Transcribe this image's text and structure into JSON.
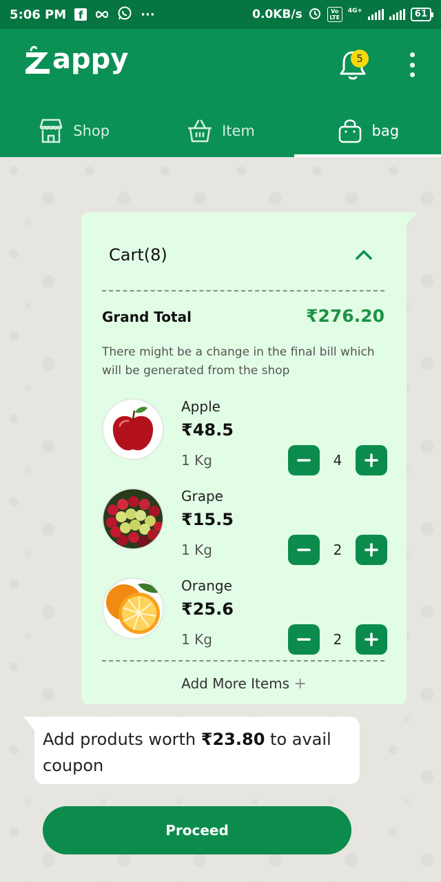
{
  "status_bar": {
    "time": "5:06 PM",
    "dots": "···",
    "speed": "0.0KB/s",
    "network": "4G+",
    "volte": "Vo LTE",
    "battery": "61"
  },
  "app": {
    "logo_text": "appy",
    "notification_count": "5"
  },
  "tabs": [
    {
      "label": "Shop",
      "icon": "shop-icon",
      "active": false
    },
    {
      "label": "Item",
      "icon": "basket-icon",
      "active": false
    },
    {
      "label": "bag",
      "icon": "bag-icon",
      "active": true
    }
  ],
  "cart": {
    "title": "Cart(8)",
    "grand_total_label": "Grand Total",
    "grand_total_value": "₹276.20",
    "note": "There might be a change in the final bill which will be generated from the shop",
    "items": [
      {
        "name": "Apple",
        "price": "₹48.5",
        "unit": "1 Kg",
        "qty": "4",
        "image": "apple-image"
      },
      {
        "name": "Grape",
        "price": "₹15.5",
        "unit": "1 Kg",
        "qty": "2",
        "image": "grape-image"
      },
      {
        "name": "Orange",
        "price": "₹25.6",
        "unit": "1 Kg",
        "qty": "2",
        "image": "orange-image"
      }
    ],
    "add_more_label": "Add More Items",
    "add_more_icon": "+"
  },
  "coupon": {
    "prefix": "Add produts worth ",
    "amount": "₹23.80",
    "suffix": " to avail coupon"
  },
  "proceed_label": "Proceed",
  "colors": {
    "primary": "#0b9155",
    "status_bar": "#067542",
    "button": "#0b8c4d",
    "card_bg": "#e2fde6",
    "total_green": "#1e9245",
    "badge": "#f5d90b"
  }
}
